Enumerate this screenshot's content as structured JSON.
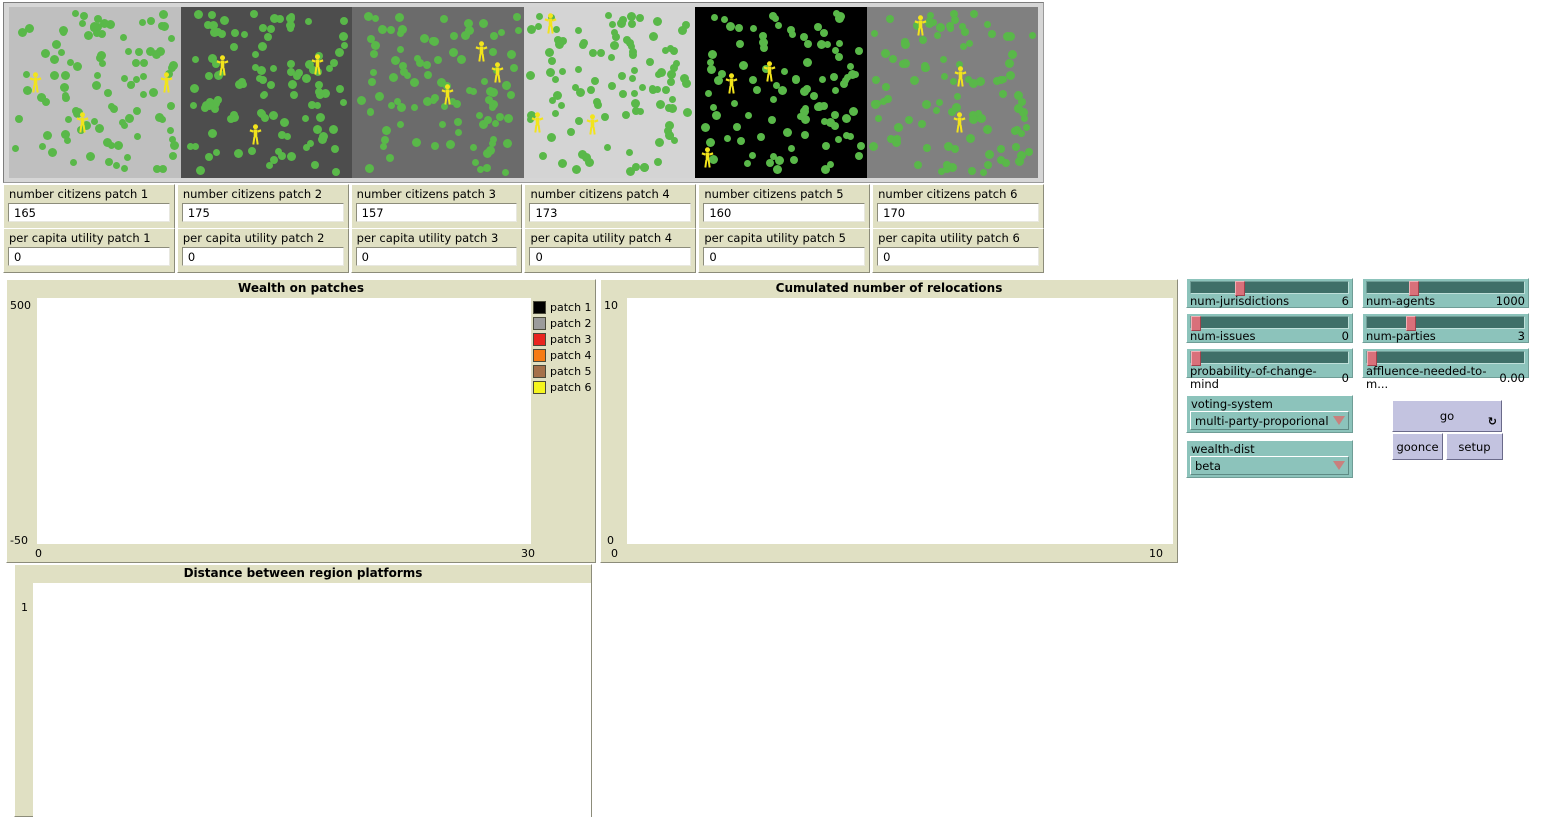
{
  "world": {
    "patches": [
      {
        "name": "patch-1",
        "bg": "#bfbfbf",
        "citizens": 165
      },
      {
        "name": "patch-2",
        "bg": "#4d4d4d",
        "citizens": 175
      },
      {
        "name": "patch-3",
        "bg": "#6b6b6b",
        "citizens": 157
      },
      {
        "name": "patch-4",
        "bg": "#d4d4d4",
        "citizens": 173
      },
      {
        "name": "patch-5",
        "bg": "#000000",
        "citizens": 160
      },
      {
        "name": "patch-6",
        "bg": "#808080",
        "citizens": 170
      }
    ],
    "citizen_color": "#59b849",
    "agent_color": "#f2e41c"
  },
  "monitors": {
    "citizens": [
      {
        "label": "number citizens patch 1",
        "value": "165"
      },
      {
        "label": "number citizens patch 2",
        "value": "175"
      },
      {
        "label": "number citizens patch 3",
        "value": "157"
      },
      {
        "label": "number citizens patch 4",
        "value": "173"
      },
      {
        "label": "number citizens patch 5",
        "value": "160"
      },
      {
        "label": "number citizens patch 6",
        "value": "170"
      }
    ],
    "utility": [
      {
        "label": "per capita utility patch 1",
        "value": "0"
      },
      {
        "label": "per capita utility patch 2",
        "value": "0"
      },
      {
        "label": "per capita utility patch 3",
        "value": "0"
      },
      {
        "label": "per capita utility patch 4",
        "value": "0"
      },
      {
        "label": "per capita utility patch 5",
        "value": "0"
      },
      {
        "label": "per capita utility patch 6",
        "value": "0"
      }
    ]
  },
  "chart_data": [
    {
      "type": "line",
      "title": "Wealth on patches",
      "xlabel": "",
      "ylabel": "",
      "xlim": [
        0,
        30
      ],
      "ylim": [
        -50,
        500
      ],
      "xticks": [
        "0",
        "30"
      ],
      "yticks": [
        "500",
        "-50"
      ],
      "grid": false,
      "legend_position": "right",
      "series": [
        {
          "name": "patch 1",
          "color": "#000000",
          "values": []
        },
        {
          "name": "patch 2",
          "color": "#9b9b9b",
          "values": []
        },
        {
          "name": "patch 3",
          "color": "#e8251f",
          "values": []
        },
        {
          "name": "patch 4",
          "color": "#f57c14",
          "values": []
        },
        {
          "name": "patch 5",
          "color": "#a5714a",
          "values": []
        },
        {
          "name": "patch 6",
          "color": "#f5f51e",
          "values": []
        }
      ]
    },
    {
      "type": "line",
      "title": "Cumulated number of relocations",
      "xlabel": "",
      "ylabel": "",
      "xlim": [
        0,
        10
      ],
      "ylim": [
        0,
        10
      ],
      "xticks": [
        "0",
        "10"
      ],
      "yticks": [
        "10",
        "0"
      ],
      "grid": false,
      "legend_position": "none",
      "series": []
    },
    {
      "type": "line",
      "title": "Distance between region platforms",
      "xlabel": "",
      "ylabel": "",
      "ylim": [
        0,
        1
      ],
      "yticks": [
        "1"
      ],
      "xticks": [],
      "grid": false,
      "legend_position": "none",
      "series": []
    }
  ],
  "controls": {
    "sliders": [
      {
        "name": "num-jurisdictions",
        "label": "num-jurisdictions",
        "value": "6",
        "thumb_pct": 28
      },
      {
        "name": "num-agents",
        "label": "num-agents",
        "value": "1000",
        "thumb_pct": 27
      },
      {
        "name": "num-issues",
        "label": "num-issues",
        "value": "0",
        "thumb_pct": 0
      },
      {
        "name": "num-parties",
        "label": "num-parties",
        "value": "3",
        "thumb_pct": 25
      },
      {
        "name": "probability-of-change-mind",
        "label": "probability-of-change-mind",
        "value": "0",
        "thumb_pct": 0
      },
      {
        "name": "affluence-needed-to-move",
        "label": "affluence-needed-to-m...",
        "value": "0.00",
        "thumb_pct": 0
      }
    ],
    "choosers": [
      {
        "name": "voting-system",
        "label": "voting-system",
        "value": "multi-party-proporional"
      },
      {
        "name": "wealth-dist",
        "label": "wealth-dist",
        "value": "beta"
      }
    ],
    "buttons": [
      {
        "name": "go",
        "label": "go",
        "forever": "↻"
      },
      {
        "name": "goonce",
        "label": "goonce",
        "forever": ""
      },
      {
        "name": "setup",
        "label": "setup",
        "forever": ""
      }
    ]
  }
}
